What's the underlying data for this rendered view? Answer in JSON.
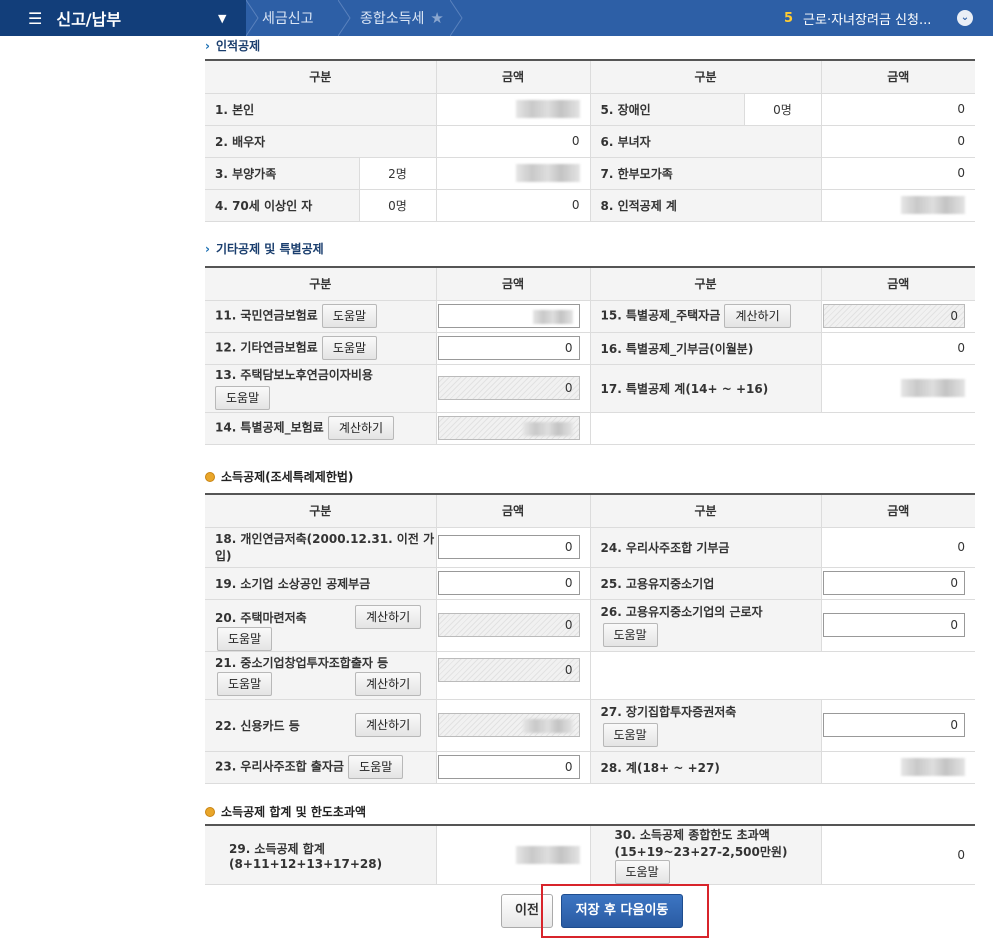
{
  "topbar": {
    "menu_title": "신고/납부",
    "crumbs": [
      "세금신고",
      "종합소득세"
    ],
    "step_number": "5",
    "step_label": "근로·자녀장려금 신청..."
  },
  "sections": {
    "personal": "인적공제",
    "other": "기타공제 및 특별공제",
    "income": "소득공제(조세특례제한법)",
    "total": "소득공제 합계 및 한도초과액"
  },
  "headers": {
    "category": "구분",
    "amount": "금액"
  },
  "buttons": {
    "help": "도움말",
    "calc": "계산하기",
    "prev": "이전",
    "save_next": "저장 후 다음이동"
  },
  "personal": {
    "r1": {
      "label": "1. 본인",
      "label2": "5. 장애인",
      "count2": "0명",
      "amount2": "0"
    },
    "r2": {
      "label": "2. 배우자",
      "amount": "0",
      "label2": "6. 부녀자",
      "amount2": "0"
    },
    "r3": {
      "label": "3. 부양가족",
      "count": "2명",
      "label2": "7. 한부모가족",
      "amount2": "0"
    },
    "r4": {
      "label": "4. 70세 이상인 자",
      "count": "0명",
      "amount": "0",
      "label2": "8. 인적공제 계"
    }
  },
  "other": {
    "r11": {
      "label": "11. 국민연금보험료"
    },
    "r15": {
      "label": "15. 특별공제_주택자금",
      "value": "0"
    },
    "r12": {
      "label": "12. 기타연금보험료",
      "value": "0"
    },
    "r16": {
      "label": "16. 특별공제_기부금(이월분)",
      "value": "0"
    },
    "r13": {
      "label": "13. 주택담보노후연금이자비용",
      "value": "0"
    },
    "r17": {
      "label": "17. 특별공제 계(14+ ~ +16)"
    },
    "r14": {
      "label": "14. 특별공제_보험료"
    }
  },
  "income": {
    "r18": {
      "label": "18. 개인연금저축(2000.12.31. 이전 가입)",
      "value": "0"
    },
    "r24": {
      "label": "24. 우리사주조합 기부금",
      "value": "0"
    },
    "r19": {
      "label": "19. 소기업 소상공인 공제부금",
      "value": "0"
    },
    "r25": {
      "label": "25. 고용유지중소기업",
      "value": "0"
    },
    "r20": {
      "label": "20. 주택마련저축",
      "value": "0"
    },
    "r26": {
      "label": "26. 고용유지중소기업의 근로자",
      "value": "0"
    },
    "r21": {
      "label": "21. 중소기업창업투자조합출자 등",
      "value": "0"
    },
    "r22": {
      "label": "22. 신용카드 등"
    },
    "r27": {
      "label": "27. 장기집합투자증권저축",
      "value": "0"
    },
    "r23": {
      "label": "23. 우리사주조합 출자금",
      "value": "0"
    },
    "r28": {
      "label": "28. 계(18+ ~ +27)"
    }
  },
  "total": {
    "r29": {
      "label": "29. 소득공제 합계(8+11+12+13+17+28)"
    },
    "r30": {
      "label": "30. 소득공제 종합한도 초과액(15+19~23+27-2,500만원)",
      "value": "0"
    }
  }
}
